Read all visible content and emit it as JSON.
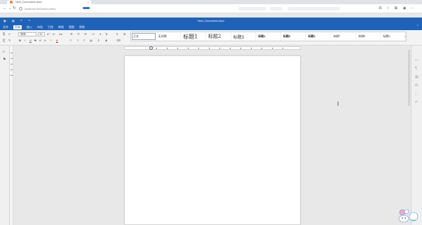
{
  "browser": {
    "tab_title": "New_Document.docx",
    "tab_close": "×",
    "url": "localhost:3000/document",
    "nav": {
      "back": "←",
      "forward": "→",
      "reload": "↻"
    }
  },
  "app": {
    "title": "New_Document.docx",
    "menu": [
      "文件",
      "开始",
      "插入",
      "布局",
      "引用",
      "审阅",
      "视图",
      "帮助"
    ],
    "active_menu": "开始",
    "more": "⌃"
  },
  "toolbar": {
    "font": "宋体",
    "size": "10",
    "format_row1": "B I U S A A",
    "styles": [
      "正文",
      "无间隔",
      "标题1",
      "标题2",
      "标题3",
      "标题4",
      "标题5",
      "标题6",
      "标题7",
      "标题8",
      "标题9"
    ],
    "styles_arrow": "⌄"
  },
  "colors": {
    "accent": "#1e63b8",
    "toolbar_bg": "#f3f3f3",
    "page_bg": "#ffffff",
    "canvas_bg": "#e8e8e8"
  },
  "icons": {
    "text_cursor": "I"
  }
}
